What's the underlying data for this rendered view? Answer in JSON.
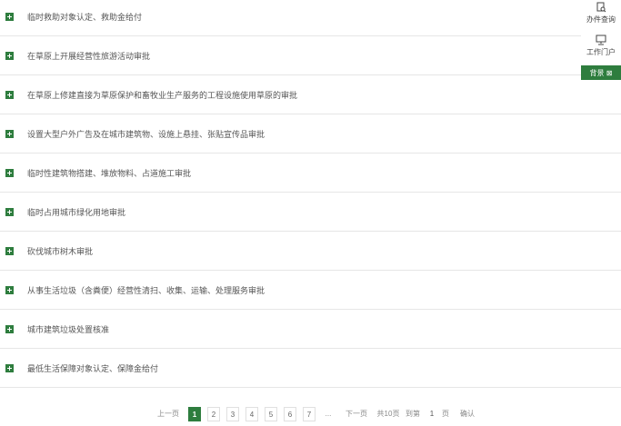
{
  "items": [
    {
      "label": "临时救助对象认定、救助金给付"
    },
    {
      "label": "在草原上开展经营性旅游活动审批"
    },
    {
      "label": "在草原上修建直接为草原保护和畜牧业生产服务的工程设施使用草原的审批"
    },
    {
      "label": "设置大型户外广告及在城市建筑物、设施上悬挂、张贴宣传品审批"
    },
    {
      "label": "临时性建筑物搭建、堆放物料、占道施工审批"
    },
    {
      "label": "临时占用城市绿化用地审批"
    },
    {
      "label": "砍伐城市树木审批"
    },
    {
      "label": "从事生活垃圾（含粪便）经营性清扫、收集、运输、处理服务审批"
    },
    {
      "label": "城市建筑垃圾处置核准"
    },
    {
      "label": "最低生活保障对象认定、保障金给付"
    }
  ],
  "side": {
    "item1": "办件查询",
    "item2": "工作门户",
    "green": "背景 ⊠"
  },
  "pager": {
    "prev": "上一页",
    "pages": [
      "1",
      "2",
      "3",
      "4",
      "5",
      "6",
      "7"
    ],
    "ellipsis": "...",
    "next": "下一页",
    "total": "共10页",
    "goto": "到第",
    "page_input": "1",
    "page_unit": "页",
    "confirm": "确认",
    "active_page": "1"
  },
  "colors": {
    "accent": "#2e7d3e",
    "divider": "#e6e6e6"
  }
}
